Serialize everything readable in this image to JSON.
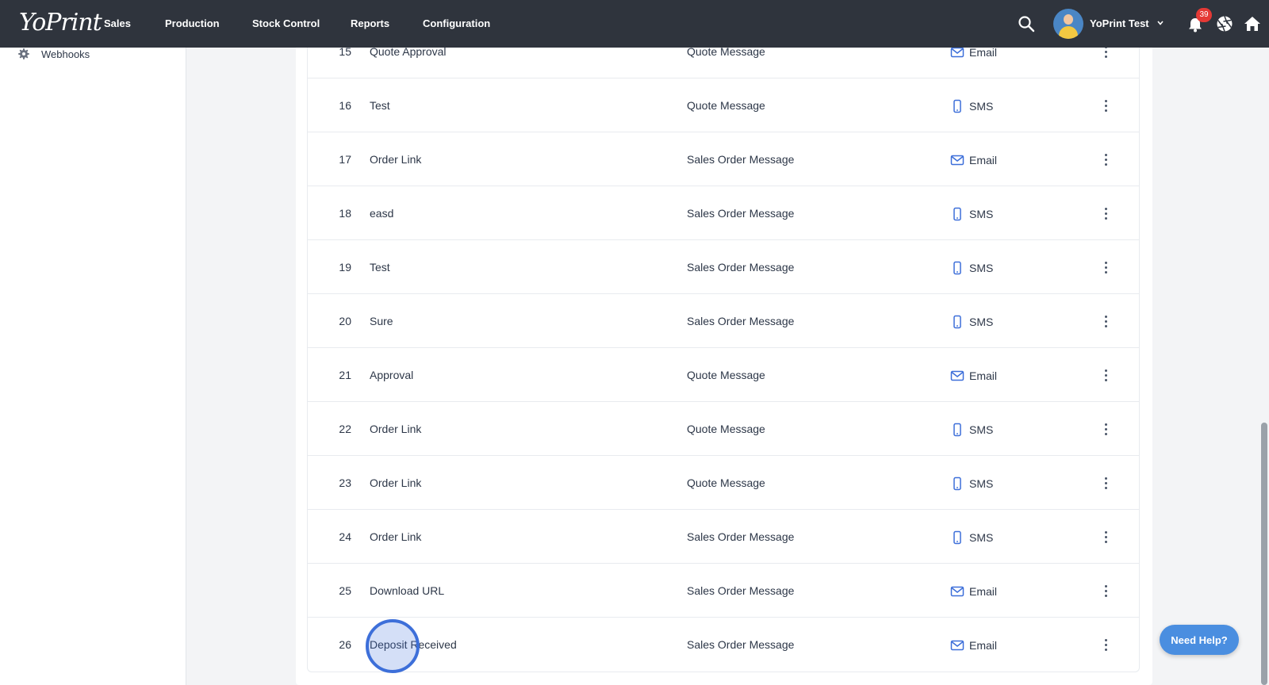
{
  "header": {
    "logo": "YoPrint",
    "nav": [
      "Sales",
      "Production",
      "Stock Control",
      "Reports",
      "Configuration"
    ],
    "user_name": "YoPrint Test",
    "notification_count": "39",
    "icons": [
      "search-icon",
      "chevron-down-icon",
      "bell-icon",
      "aperture-icon",
      "home-icon"
    ]
  },
  "sidebar": {
    "items": [
      {
        "label": "Webhooks",
        "icon": "gear-icon"
      }
    ]
  },
  "table": {
    "rows": [
      {
        "id": "15",
        "name": "Quote Approval",
        "type": "Quote Message",
        "channel": "Email"
      },
      {
        "id": "16",
        "name": "Test",
        "type": "Quote Message",
        "channel": "SMS"
      },
      {
        "id": "17",
        "name": "Order Link",
        "type": "Sales Order Message",
        "channel": "Email"
      },
      {
        "id": "18",
        "name": "easd",
        "type": "Sales Order Message",
        "channel": "SMS"
      },
      {
        "id": "19",
        "name": "Test",
        "type": "Sales Order Message",
        "channel": "SMS"
      },
      {
        "id": "20",
        "name": "Sure",
        "type": "Sales Order Message",
        "channel": "SMS"
      },
      {
        "id": "21",
        "name": "Approval",
        "type": "Quote Message",
        "channel": "Email"
      },
      {
        "id": "22",
        "name": "Order Link",
        "type": "Quote Message",
        "channel": "SMS"
      },
      {
        "id": "23",
        "name": "Order Link",
        "type": "Quote Message",
        "channel": "SMS"
      },
      {
        "id": "24",
        "name": "Order Link",
        "type": "Sales Order Message",
        "channel": "SMS"
      },
      {
        "id": "25",
        "name": "Download URL",
        "type": "Sales Order Message",
        "channel": "Email"
      },
      {
        "id": "26",
        "name": "Deposit Received",
        "type": "Sales Order Message",
        "channel": "Email"
      }
    ]
  },
  "help_button": {
    "label": "Need Help?"
  },
  "colors": {
    "topbar": "#2f343d",
    "accent": "#3d6fd9",
    "help": "#4a8ee0",
    "badge": "#e53935"
  }
}
